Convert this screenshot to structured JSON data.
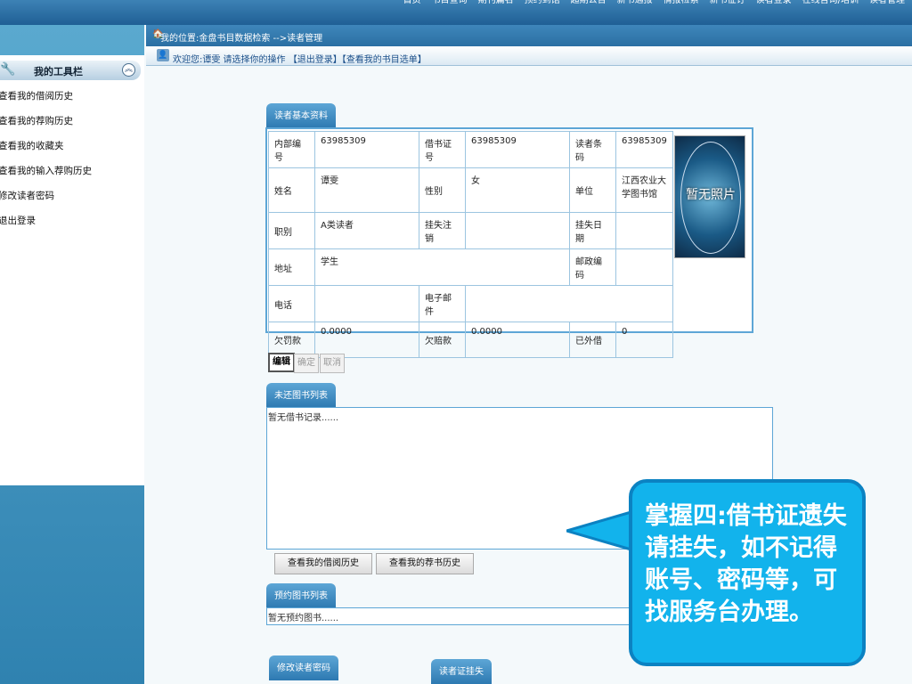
{
  "topnav": [
    "首页",
    "书目查询",
    "期刊篇名",
    "预约到馆",
    "超期公告",
    "新书通报",
    "情报检索",
    "新书征订",
    "读者登录",
    "在线咨询/培训",
    "读者管理"
  ],
  "sidebar": {
    "title": "我的工具栏",
    "items": [
      "查看我的借阅历史",
      "查看我的荐购历史",
      "查看我的收藏夹",
      "查看我的输入荐购历史",
      "修改读者密码",
      "退出登录"
    ]
  },
  "location": "我的位置:金盘书目数据检索 -->读者管理",
  "welcome": {
    "text": "欢迎您:谭雯  请选择你的操作",
    "logout": "【退出登录】",
    "mylist": "【查看我的书目选单】"
  },
  "reader": {
    "tab": "读者基本资料",
    "rows": [
      [
        {
          "l": "内部编号"
        },
        {
          "v": "63985309"
        },
        {
          "l": "借书证号"
        },
        {
          "v": "63985309"
        },
        {
          "l": "读者条码"
        },
        {
          "v": "63985309"
        }
      ],
      [
        {
          "l": "姓名"
        },
        {
          "v": "谭雯"
        },
        {
          "l": "性别"
        },
        {
          "v": "女"
        },
        {
          "l": "单位"
        },
        {
          "v": "江西农业大学图书馆"
        }
      ],
      [
        {
          "l": "职别"
        },
        {
          "v": "A类读者"
        },
        {
          "l": "挂失注销"
        },
        {
          "v": ""
        },
        {
          "l": "挂失日期"
        },
        {
          "v": ""
        }
      ],
      [
        {
          "l": "地址"
        },
        {
          "v": "学生"
        },
        {
          "l": "邮政编码"
        },
        {
          "v": ""
        }
      ],
      [
        {
          "l": "电话"
        },
        {
          "v": ""
        },
        {
          "l": "电子邮件"
        },
        {
          "v": ""
        }
      ],
      [
        {
          "l": "欠罚款"
        },
        {
          "v": "0.0000"
        },
        {
          "l": "欠赔款"
        },
        {
          "v": "0.0000"
        },
        {
          "l": "已外借"
        },
        {
          "v": "0"
        }
      ]
    ],
    "photo": "暂无照片"
  },
  "actions": {
    "edit": "编辑",
    "confirm": "确定",
    "cancel": "取消"
  },
  "borrowed": {
    "tab": "未还图书列表",
    "empty": "暂无借书记录......"
  },
  "buttons": {
    "history": "查看我的借阅历史",
    "recommend": "查看我的荐书历史"
  },
  "reserved": {
    "tab": "预约图书列表",
    "empty": "暂无预约图书......"
  },
  "bottom_tabs": {
    "password": "修改读者密码",
    "loss": "读者证挂失"
  },
  "callout": "掌握四:借书证遗失请挂失，如不记得账号、密码等，可找服务台办理。"
}
